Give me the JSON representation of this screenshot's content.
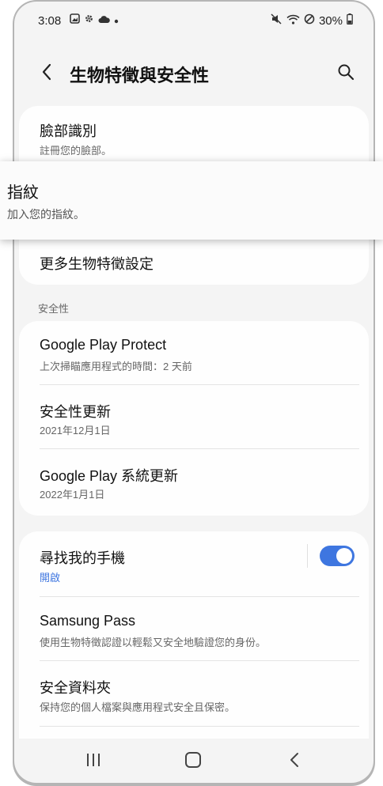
{
  "status_bar": {
    "time": "3:08",
    "battery": "30%"
  },
  "app_bar": {
    "title": "生物特徵與安全性"
  },
  "biometrics": {
    "face": {
      "title": "臉部識別",
      "subtitle": "註冊您的臉部。"
    },
    "more": {
      "title": "更多生物特徵設定"
    }
  },
  "fingerprint_popup": {
    "title": "指紋",
    "subtitle": "加入您的指紋。"
  },
  "security": {
    "header": "安全性",
    "items": [
      {
        "title": "Google Play Protect",
        "subtitle": "上次掃瞄應用程式的時間：2 天前"
      },
      {
        "title": "安全性更新",
        "subtitle": "2021年12月1日"
      },
      {
        "title": "Google Play 系統更新",
        "subtitle": "2022年1月1日"
      }
    ]
  },
  "device": {
    "find_my_mobile": {
      "title": "尋找我的手機",
      "status": "開啟",
      "toggle_on": true
    },
    "samsung_pass": {
      "title": "Samsung Pass",
      "subtitle": "使用生物特徵認證以輕鬆又安全地驗證您的身份。"
    },
    "secure_folder": {
      "title": "安全資料夾",
      "subtitle": "保持您的個人檔案與應用程式安全且保密。"
    }
  },
  "colors": {
    "accent": "#3e76e0",
    "background": "#f4f4f4",
    "card": "#fefefe"
  }
}
